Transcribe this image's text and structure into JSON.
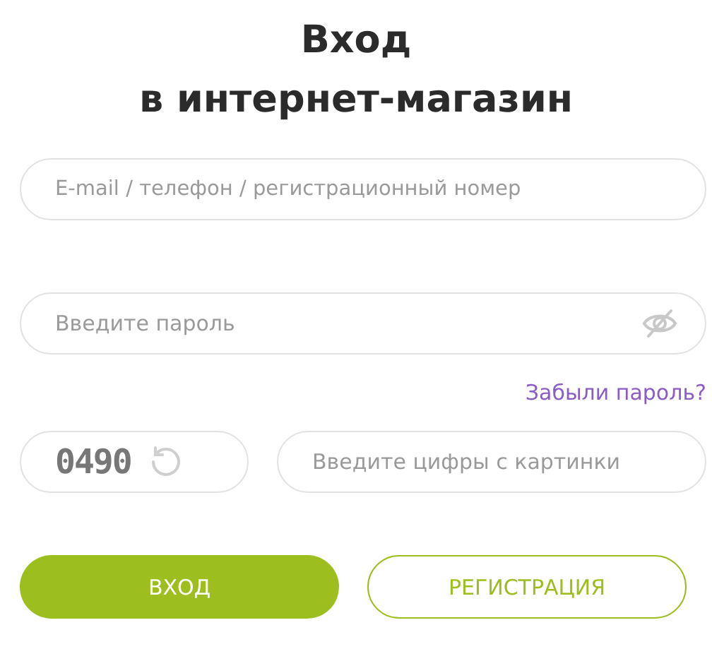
{
  "title": [
    "Вход",
    "в интернет-магазин"
  ],
  "login": {
    "placeholder": "E-mail / телефон / регистрационный номер"
  },
  "password": {
    "placeholder": "Введите пароль"
  },
  "forgot_link": "Забыли пароль?",
  "captcha": {
    "digits": "0490"
  },
  "captcha_input": {
    "placeholder": "Введите цифры с картинки"
  },
  "buttons": [
    {
      "kind": "primary",
      "label": "ВХОД"
    },
    {
      "kind": "secondary",
      "label": "РЕГИСТРАЦИЯ"
    }
  ]
}
